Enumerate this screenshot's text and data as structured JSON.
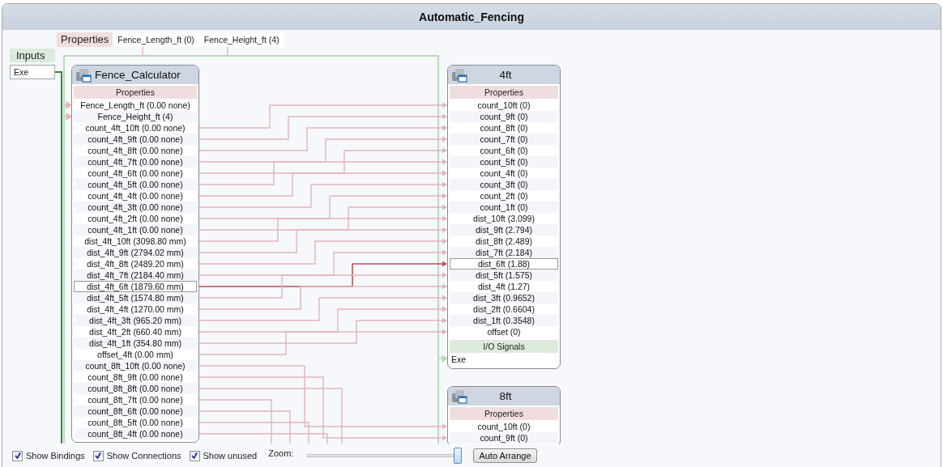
{
  "window": {
    "title": "Automatic_Fencing"
  },
  "properties_bar": {
    "label": "Properties",
    "items": [
      "Fence_Length_ft (0)",
      "Fence_Height_ft (4)"
    ]
  },
  "inputs": {
    "label": "Inputs",
    "items": [
      "Exe"
    ]
  },
  "nodes": [
    {
      "title": "Fence_Calculator",
      "section": "Properties",
      "rows": [
        {
          "text": "Fence_Length_ft (0.00 none)",
          "kind": "input",
          "selected": false
        },
        {
          "text": "Fence_Height_ft (4)",
          "kind": "input",
          "selected": false
        },
        {
          "text": "count_4ft_10ft (0.00 none)",
          "kind": "output",
          "selected": false
        },
        {
          "text": "count_4ft_9ft (0.00 none)",
          "kind": "output",
          "selected": false
        },
        {
          "text": "count_4ft_8ft (0.00 none)",
          "kind": "output",
          "selected": false
        },
        {
          "text": "count_4ft_7ft (0.00 none)",
          "kind": "output",
          "selected": false
        },
        {
          "text": "count_4ft_6ft (0.00 none)",
          "kind": "output",
          "selected": false
        },
        {
          "text": "count_4ft_5ft (0.00 none)",
          "kind": "output",
          "selected": false
        },
        {
          "text": "count_4ft_4ft (0.00 none)",
          "kind": "output",
          "selected": false
        },
        {
          "text": "count_4ft_3ft (0.00 none)",
          "kind": "output",
          "selected": false
        },
        {
          "text": "count_4ft_2ft (0.00 none)",
          "kind": "output",
          "selected": false
        },
        {
          "text": "count_4ft_1ft (0.00 none)",
          "kind": "output",
          "selected": false
        },
        {
          "text": "dist_4ft_10ft (3098.80 mm)",
          "kind": "output",
          "selected": false
        },
        {
          "text": "dist_4ft_9ft (2794.02 mm)",
          "kind": "output",
          "selected": false
        },
        {
          "text": "dist_4ft_8ft (2489.20 mm)",
          "kind": "output",
          "selected": false
        },
        {
          "text": "dist_4ft_7ft (2184.40 mm)",
          "kind": "output",
          "selected": false
        },
        {
          "text": "dist_4ft_6ft (1879.60 mm)",
          "kind": "output",
          "selected": true
        },
        {
          "text": "dist_4ft_5ft (1574.80 mm)",
          "kind": "output",
          "selected": false
        },
        {
          "text": "dist_4ft_4ft (1270.00 mm)",
          "kind": "output",
          "selected": false
        },
        {
          "text": "dist_4ft_3ft (965.20 mm)",
          "kind": "output",
          "selected": false
        },
        {
          "text": "dist_4ft_2ft (660.40 mm)",
          "kind": "output",
          "selected": false
        },
        {
          "text": "dist_4ft_1ft (354.80 mm)",
          "kind": "output",
          "selected": false
        },
        {
          "text": "offset_4ft (0.00 mm)",
          "kind": "output",
          "selected": false
        },
        {
          "text": "count_8ft_10ft (0.00 none)",
          "kind": "output",
          "selected": false
        },
        {
          "text": "count_8ft_9ft (0.00 none)",
          "kind": "output",
          "selected": false
        },
        {
          "text": "count_8ft_8ft (0.00 none)",
          "kind": "output",
          "selected": false
        },
        {
          "text": "count_8ft_7ft (0.00 none)",
          "kind": "output",
          "selected": false
        },
        {
          "text": "count_8ft_6ft (0.00 none)",
          "kind": "output",
          "selected": false
        },
        {
          "text": "count_8ft_5ft (0.00 none)",
          "kind": "output",
          "selected": false
        },
        {
          "text": "count_8ft_4ft (0.00 none)",
          "kind": "output",
          "selected": false
        }
      ]
    },
    {
      "title": "4ft",
      "section": "Properties",
      "rows": [
        {
          "text": "count_10ft (0)",
          "kind": "input",
          "selected": false
        },
        {
          "text": "count_9ft (0)",
          "kind": "input",
          "selected": false
        },
        {
          "text": "count_8ft (0)",
          "kind": "input",
          "selected": false
        },
        {
          "text": "count_7ft (0)",
          "kind": "input",
          "selected": false
        },
        {
          "text": "count_6ft (0)",
          "kind": "input",
          "selected": false
        },
        {
          "text": "count_5ft (0)",
          "kind": "input",
          "selected": false
        },
        {
          "text": "count_4ft (0)",
          "kind": "input",
          "selected": false
        },
        {
          "text": "count_3ft (0)",
          "kind": "input",
          "selected": false
        },
        {
          "text": "count_2ft (0)",
          "kind": "input",
          "selected": false
        },
        {
          "text": "count_1ft (0)",
          "kind": "input",
          "selected": false
        },
        {
          "text": "dist_10ft (3.099)",
          "kind": "input",
          "selected": false
        },
        {
          "text": "dist_9ft (2.794)",
          "kind": "input",
          "selected": false
        },
        {
          "text": "dist_8ft (2.489)",
          "kind": "input",
          "selected": false
        },
        {
          "text": "dist_7ft (2.184)",
          "kind": "input",
          "selected": false
        },
        {
          "text": "dist_6ft (1.88)",
          "kind": "input",
          "selected": true
        },
        {
          "text": "dist_5ft (1.575)",
          "kind": "input",
          "selected": false
        },
        {
          "text": "dist_4ft (1.27)",
          "kind": "input",
          "selected": false
        },
        {
          "text": "dist_3ft (0.9652)",
          "kind": "input",
          "selected": false
        },
        {
          "text": "dist_2ft (0.6604)",
          "kind": "input",
          "selected": false
        },
        {
          "text": "dist_1ft (0.3548)",
          "kind": "input",
          "selected": false
        },
        {
          "text": "offset (0)",
          "kind": "input",
          "selected": false
        }
      ],
      "signals_label": "I/O Signals",
      "signals": [
        "Exe"
      ]
    },
    {
      "title": "8ft",
      "section": "Properties",
      "rows": [
        {
          "text": "count_10ft (0)",
          "kind": "input",
          "selected": false
        },
        {
          "text": "count_9ft (0)",
          "kind": "input",
          "selected": false
        }
      ]
    }
  ],
  "toolbar": {
    "options": [
      {
        "label": "Show Bindings",
        "checked": true
      },
      {
        "label": "Show Connections",
        "checked": true
      },
      {
        "label": "Show unused",
        "checked": true
      }
    ],
    "zoom": {
      "label": "Zoom:",
      "level": 1
    },
    "button": "Auto Arrange"
  }
}
